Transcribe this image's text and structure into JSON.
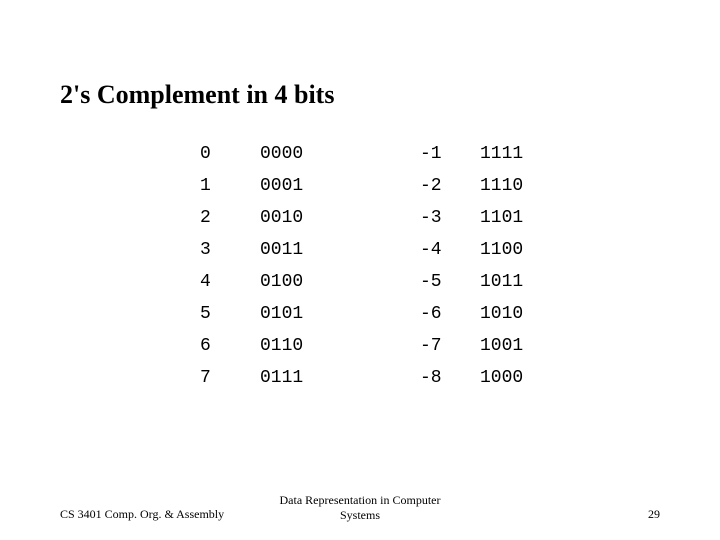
{
  "title": "2's Complement in 4 bits",
  "rows": [
    {
      "dp": "0",
      "bp": "0000",
      "dn": "-1",
      "bn": "1111"
    },
    {
      "dp": "1",
      "bp": "0001",
      "dn": "-2",
      "bn": "1110"
    },
    {
      "dp": "2",
      "bp": "0010",
      "dn": "-3",
      "bn": "1101"
    },
    {
      "dp": "3",
      "bp": "0011",
      "dn": "-4",
      "bn": "1100"
    },
    {
      "dp": "4",
      "bp": "0100",
      "dn": "-5",
      "bn": "1011"
    },
    {
      "dp": "5",
      "bp": "0101",
      "dn": "-6",
      "bn": "1010"
    },
    {
      "dp": "6",
      "bp": "0110",
      "dn": "-7",
      "bn": "1001"
    },
    {
      "dp": "7",
      "bp": "0111",
      "dn": "-8",
      "bn": "1000"
    }
  ],
  "footer": {
    "left": "CS 3401 Comp. Org. & Assembly",
    "center": "Data Representation in Computer\nSystems",
    "right": "29"
  }
}
